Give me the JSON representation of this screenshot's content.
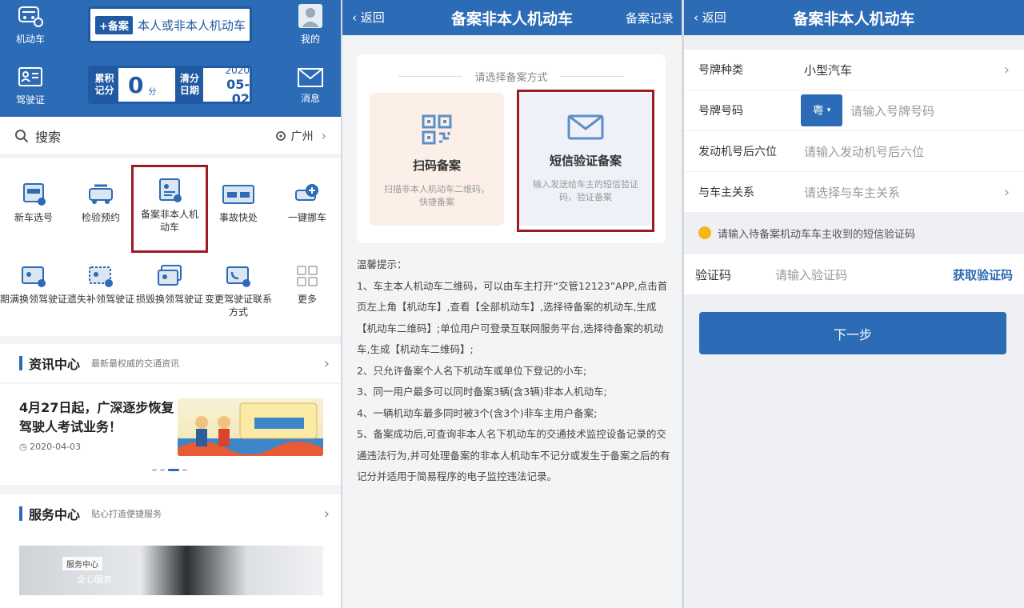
{
  "panel_home": {
    "header": {
      "vehicle_label": "机动车",
      "license_label": "驾驶证",
      "mine_label": "我的",
      "message_label": "消息",
      "plate_tag": "+备案",
      "plate_text": "本人或非本人机动车",
      "score": {
        "label_line1": "累积",
        "label_line2": "记分",
        "value": "0",
        "unit": "分",
        "clear_line1": "清分",
        "clear_line2": "日期",
        "year": "2020",
        "date": "05-02"
      }
    },
    "search": {
      "label": "搜索",
      "city": "广州"
    },
    "grid": [
      {
        "label": "新车选号",
        "icon": "new-car-plate-icon"
      },
      {
        "label": "检验预约",
        "icon": "inspection-icon"
      },
      {
        "label": "备案非本人机动车",
        "icon": "register-vehicle-icon"
      },
      {
        "label": "事故快处",
        "icon": "accident-icon"
      },
      {
        "label": "一键挪车",
        "icon": "move-car-icon"
      },
      {
        "label": "期满换领驾驶证",
        "icon": "license-renew-icon"
      },
      {
        "label": "遗失补领驾驶证",
        "icon": "license-lost-icon"
      },
      {
        "label": "损毁换领驾驶证",
        "icon": "license-damaged-icon"
      },
      {
        "label": "变更驾驶证联系方式",
        "icon": "contact-change-icon"
      },
      {
        "label": "更多",
        "icon": "more-icon"
      }
    ],
    "news": {
      "title": "资讯中心",
      "subtitle": "最新最权威的交通资讯",
      "item_title": "4月27日起，广深逐步恢复驾驶人考试业务！",
      "item_date": "2020-04-03"
    },
    "service": {
      "title": "服务中心",
      "subtitle": "贴心打造便捷服务",
      "badge": "服务中心",
      "caption": "全心服务"
    }
  },
  "panel_choose": {
    "nav": {
      "back": "返回",
      "title": "备案非本人机动车",
      "right": "备案记录"
    },
    "choose_label": "请选择备案方式",
    "options": [
      {
        "title": "扫码备案",
        "desc": "扫描非本人机动车二维码，快捷备案",
        "icon": "qr-code-icon"
      },
      {
        "title": "短信验证备案",
        "desc": "输入发送给车主的短信验证码，验证备案",
        "icon": "envelope-icon"
      }
    ],
    "tips": [
      "温馨提示：",
      "1、车主本人机动车二维码，可以由车主打开“交管12123”APP,点击首页左上角【机动车】,查看【全部机动车】,选择待备案的机动车,生成【机动车二维码】;单位用户可登录互联网服务平台,选择待备案的机动车,生成【机动车二维码】;",
      "2、只允许备案个人名下机动车或单位下登记的小车;",
      "3、同一用户最多可以同时备案3辆(含3辆)非本人机动车;",
      "4、一辆机动车最多同时被3个(含3个)非车主用户备案;",
      "5、备案成功后,可查询非本人名下机动车的交通技术监控设备记录的交通违法行为,并可处理备案的非本人机动车不记分或发生于备案之后的有记分并适用于简易程序的电子监控违法记录。"
    ]
  },
  "panel_form": {
    "nav": {
      "back": "返回",
      "title": "备案非本人机动车"
    },
    "fields": {
      "plate_type_label": "号牌种类",
      "plate_type_value": "小型汽车",
      "plate_no_label": "号牌号码",
      "province": "粤",
      "plate_no_placeholder": "请输入号牌号码",
      "engine_label": "发动机号后六位",
      "engine_placeholder": "请输入发动机号后六位",
      "relation_label": "与车主关系",
      "relation_placeholder": "请选择与车主关系"
    },
    "notice": "请输入待备案机动车车主收到的短信验证码",
    "code": {
      "label": "验证码",
      "placeholder": "请输入验证码",
      "get": "获取验证码"
    },
    "next": "下一步"
  },
  "colors": {
    "primary": "#2c6bb6",
    "highlight": "#9c1c24",
    "notice_dot": "#f6b819"
  }
}
